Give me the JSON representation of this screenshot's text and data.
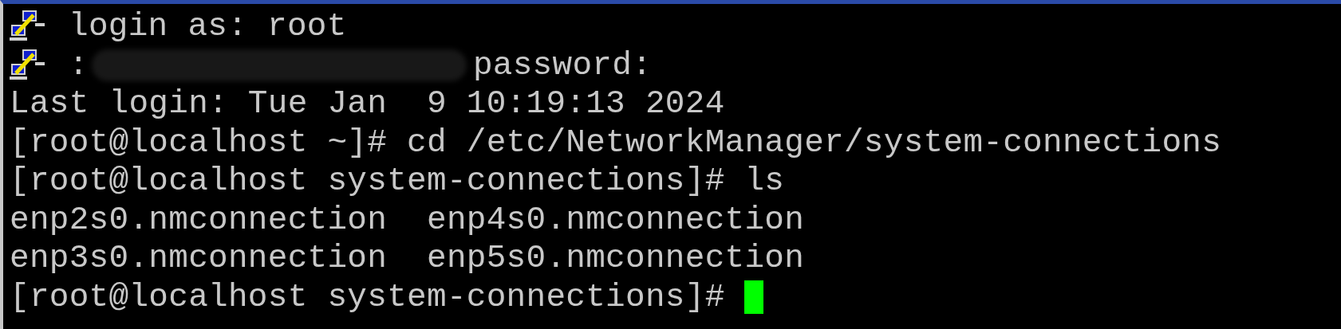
{
  "lines": [
    {
      "kind": "server",
      "text": "login as: root"
    },
    {
      "kind": "server",
      "text": ":",
      "redacted": true,
      "after": "password:"
    },
    {
      "kind": "plain",
      "text": "Last login: Tue Jan  9 10:19:13 2024"
    },
    {
      "kind": "plain",
      "text": "[root@localhost ~]# cd /etc/NetworkManager/system-connections"
    },
    {
      "kind": "plain",
      "text": "[root@localhost system-connections]# ls"
    },
    {
      "kind": "plain",
      "text": "enp2s0.nmconnection  enp4s0.nmconnection"
    },
    {
      "kind": "plain",
      "text": "enp3s0.nmconnection  enp5s0.nmconnection"
    },
    {
      "kind": "prompt",
      "text": "[root@localhost system-connections]# "
    }
  ]
}
